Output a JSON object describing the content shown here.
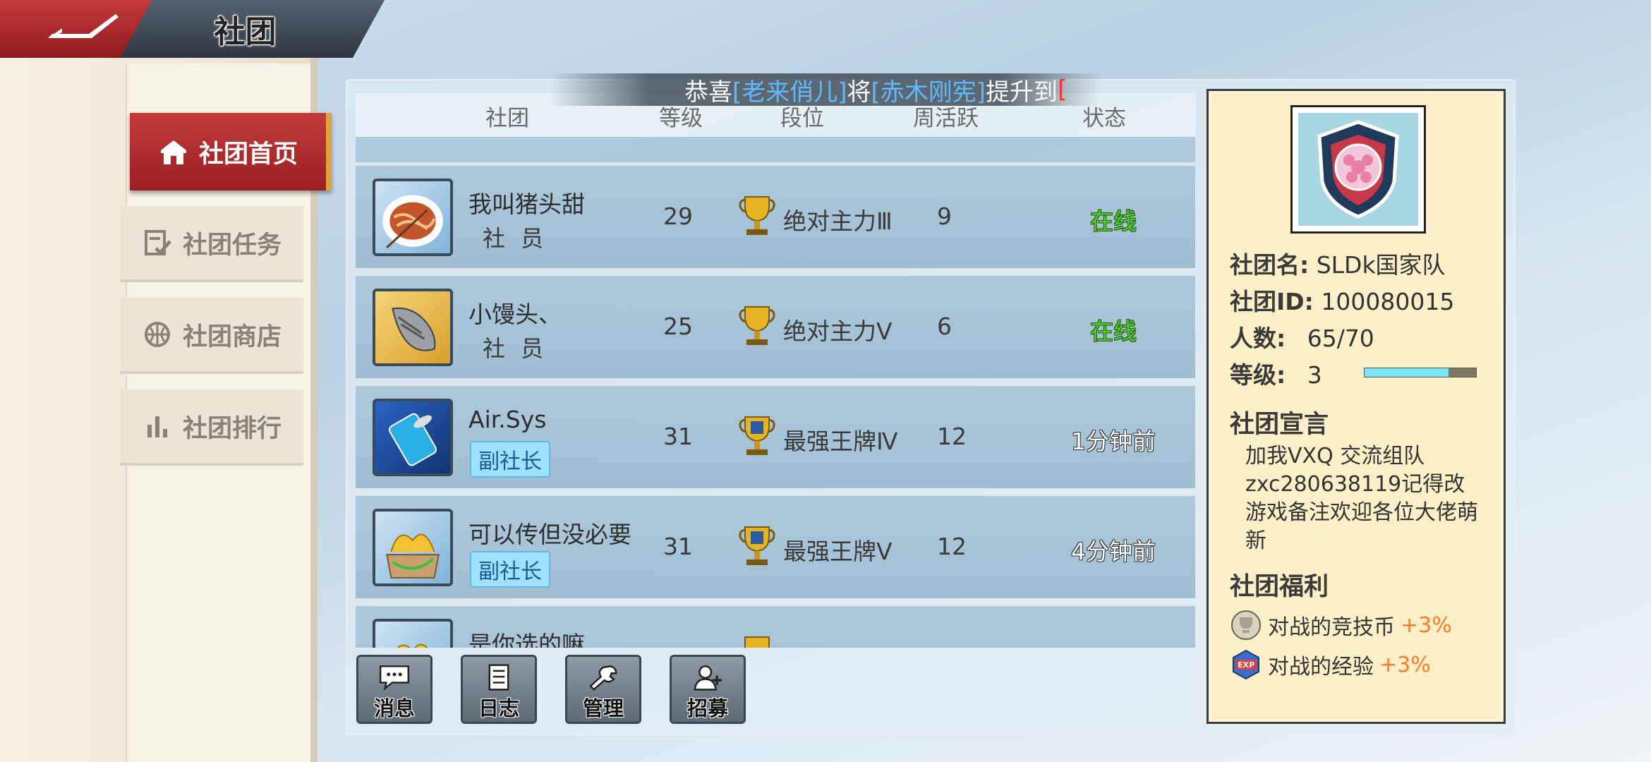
{
  "header": {
    "title": "社团"
  },
  "sidebar": {
    "items": [
      {
        "label": "社团首页",
        "icon": "home-icon",
        "active": true
      },
      {
        "label": "社团任务",
        "icon": "task-check-icon",
        "active": false
      },
      {
        "label": "社团商店",
        "icon": "basketball-shop-icon",
        "active": false
      },
      {
        "label": "社团排行",
        "icon": "bar-chart-icon",
        "active": false
      }
    ]
  },
  "ticker": {
    "prefix": "恭喜",
    "name1": "[老来俏儿]",
    "mid": "将",
    "name2": "[赤木刚宪]",
    "suffix": "提升到",
    "cursor": "["
  },
  "list": {
    "headers": {
      "club": "社团",
      "level": "等级",
      "rank": "段位",
      "weekly": "周活跃",
      "status": "状态"
    },
    "rows": [
      {
        "name": "我叫猪头甜",
        "role": "社 员",
        "role_badge": false,
        "level": "29",
        "rank": "绝对主力Ⅲ",
        "rank_icon": "gold-trophy-icon",
        "weekly": "9",
        "status": "在线",
        "status_type": "online",
        "avatar": "noodle-plate-avatar"
      },
      {
        "name": "小馒头、",
        "role": "社 员",
        "role_badge": false,
        "level": "25",
        "rank": "绝对主力Ⅴ",
        "rank_icon": "gold-trophy-icon",
        "weekly": "6",
        "status": "在线",
        "status_type": "online",
        "avatar": "sneaker-avatar"
      },
      {
        "name": "Air.Sys",
        "role": "副社长",
        "role_badge": true,
        "level": "31",
        "rank": "最强王牌Ⅳ",
        "rank_icon": "ace-trophy-icon",
        "weekly": "12",
        "status": "1分钟前",
        "status_type": "ago",
        "avatar": "soda-can-avatar"
      },
      {
        "name": "可以传但没必要",
        "role": "副社长",
        "role_badge": true,
        "level": "31",
        "rank": "最强王牌Ⅴ",
        "rank_icon": "ace-trophy-icon",
        "weekly": "12",
        "status": "4分钟前",
        "status_type": "ago",
        "avatar": "banana-box-avatar"
      },
      {
        "name": "是你选的嘛",
        "role": "",
        "role_badge": false,
        "level": "",
        "rank": "",
        "rank_icon": "gold-trophy-icon",
        "weekly": "",
        "status": "",
        "status_type": "ago",
        "avatar": "banana-box-avatar"
      }
    ]
  },
  "toolbar": {
    "buttons": [
      {
        "label": "消息",
        "icon": "chat-bubble-icon"
      },
      {
        "label": "日志",
        "icon": "notebook-icon"
      },
      {
        "label": "管理",
        "icon": "wrench-icon"
      },
      {
        "label": "招募",
        "icon": "add-user-icon"
      }
    ]
  },
  "club_info": {
    "name_label": "社团名:",
    "name_value": "SLDk国家队",
    "id_label": "社团ID:",
    "id_value": "100080015",
    "members_label": "人数:",
    "members_value": "65/70",
    "level_label": "等级:",
    "level_value": "3",
    "level_progress": 0.75,
    "declaration_title": "社团宣言",
    "declaration": "加我VXQ 交流组队zxc280638119记得改游戏备注欢迎各位大佬萌新",
    "benefits_title": "社团福利",
    "benefits": [
      {
        "label": "对战的竞技币",
        "bonus": "+3%",
        "icon": "trophy-coin-icon"
      },
      {
        "label": "对战的经验",
        "bonus": "+3%",
        "icon": "exp-badge-icon"
      }
    ]
  },
  "colors": {
    "accent_red": "#b02a2d",
    "online_green": "#4bcf2a",
    "bonus_orange": "#ff7a2a",
    "badge_blue": "#9fe0ff"
  }
}
